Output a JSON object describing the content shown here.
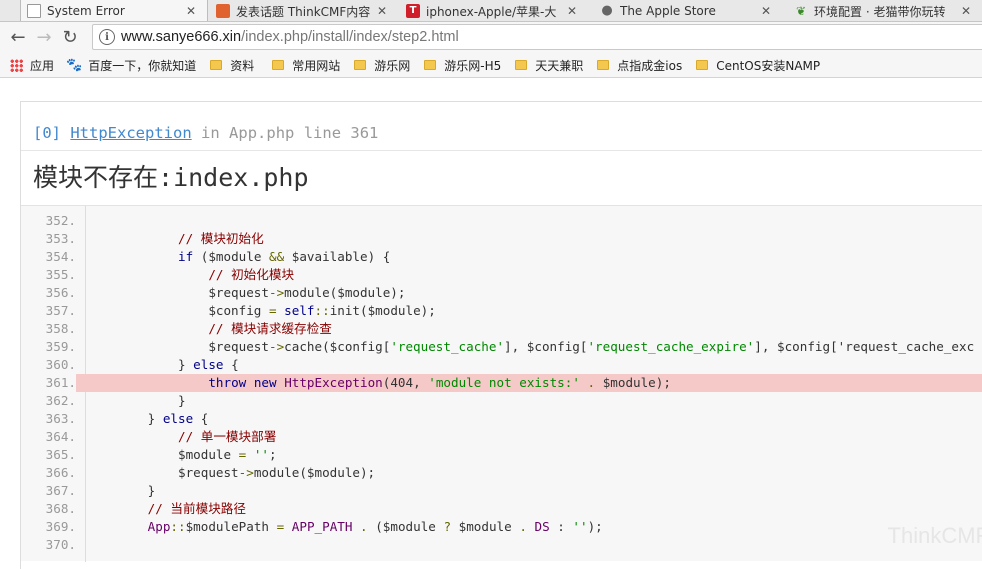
{
  "tabs": [
    {
      "title": "System Error",
      "icon": "document-icon",
      "active": true
    },
    {
      "title": "发表话题 ThinkCMF内容",
      "icon": "thinkcmf-icon",
      "active": false
    },
    {
      "title": "iphonex-Apple/苹果-大",
      "icon": "tmall-icon",
      "active": false
    },
    {
      "title": "The Apple Store",
      "icon": "apple-icon",
      "active": false
    },
    {
      "title": "环境配置 · 老猫带你玩转",
      "icon": "leaf-icon",
      "active": false
    }
  ],
  "address": {
    "host": "www.sanye666.xin",
    "path": "/index.php/install/index/step2.html"
  },
  "bookmarks": {
    "apps": "应用",
    "baidu": "百度一下，你就知道",
    "folders": [
      "资料",
      "常用网站",
      "游乐网",
      "游乐网-H5",
      "天天兼职",
      "点指成金ios",
      "CentOS安装NAMP"
    ]
  },
  "exception": {
    "index": "[0]",
    "class": "HttpException",
    "in_text": "in",
    "file": "App.php",
    "line_text": "line",
    "line": "361",
    "message_zh": "模块不存在",
    "message_rest": ":index.php"
  },
  "source": {
    "highlight_line": "361.",
    "lines": [
      {
        "n": "352.",
        "code": ""
      },
      {
        "n": "353.",
        "code": "            // 模块初始化"
      },
      {
        "n": "354.",
        "code": "            if ($module && $available) {"
      },
      {
        "n": "355.",
        "code": "                // 初始化模块"
      },
      {
        "n": "356.",
        "code": "                $request->module($module);"
      },
      {
        "n": "357.",
        "code": "                $config = self::init($module);"
      },
      {
        "n": "358.",
        "code": "                // 模块请求缓存检查"
      },
      {
        "n": "359.",
        "code": "                $request->cache($config['request_cache'], $config['request_cache_expire'], $config['request_cache_exc"
      },
      {
        "n": "360.",
        "code": "            } else {"
      },
      {
        "n": "361.",
        "code": "                throw new HttpException(404, 'module not exists:' . $module);"
      },
      {
        "n": "362.",
        "code": "            }"
      },
      {
        "n": "363.",
        "code": "        } else {"
      },
      {
        "n": "364.",
        "code": "            // 单一模块部署"
      },
      {
        "n": "365.",
        "code": "            $module = '';"
      },
      {
        "n": "366.",
        "code": "            $request->module($module);"
      },
      {
        "n": "367.",
        "code": "        }"
      },
      {
        "n": "368.",
        "code": "        // 当前模块路径"
      },
      {
        "n": "369.",
        "code": "        App::$modulePath = APP_PATH . ($module ? $module . DS : '');"
      },
      {
        "n": "370.",
        "code": ""
      }
    ]
  },
  "watermark": "ThinkCMF"
}
